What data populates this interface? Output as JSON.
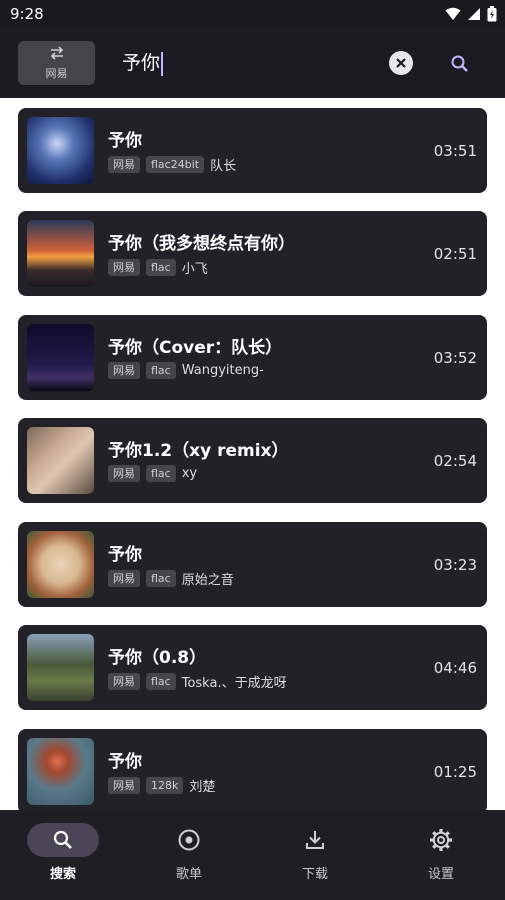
{
  "status": {
    "time": "9:28",
    "icons": [
      "wifi-icon",
      "signal-icon",
      "battery-icon"
    ]
  },
  "toolbar": {
    "source_label": "网易",
    "search_value": "予你",
    "icons": {
      "source": "swap-icon",
      "clear": "close-icon",
      "search": "search-icon"
    }
  },
  "songs": [
    {
      "title": "予你",
      "tags": [
        "网易",
        "flac24bit"
      ],
      "artist": "队长",
      "duration": "03:51"
    },
    {
      "title": "予你（我多想终点有你）",
      "tags": [
        "网易",
        "flac"
      ],
      "artist": "小飞",
      "duration": "02:51"
    },
    {
      "title": "予你（Cover：队长）",
      "tags": [
        "网易",
        "flac"
      ],
      "artist": "Wangyiteng-",
      "duration": "03:52"
    },
    {
      "title": "予你1.2（xy remix）",
      "tags": [
        "网易",
        "flac"
      ],
      "artist": "xy",
      "duration": "02:54"
    },
    {
      "title": "予你",
      "tags": [
        "网易",
        "flac"
      ],
      "artist": "原始之音",
      "duration": "03:23"
    },
    {
      "title": "予你（0.8）",
      "tags": [
        "网易",
        "flac"
      ],
      "artist": "Toska.、于成龙呀",
      "duration": "04:46"
    },
    {
      "title": "予你",
      "tags": [
        "网易",
        "128k"
      ],
      "artist": "刘楚",
      "duration": "01:25"
    }
  ],
  "nav": [
    {
      "label": "搜索",
      "icon": "search-icon",
      "active": true
    },
    {
      "label": "歌单",
      "icon": "disc-icon",
      "active": false
    },
    {
      "label": "下载",
      "icon": "download-icon",
      "active": false
    },
    {
      "label": "设置",
      "icon": "gear-icon",
      "active": false
    }
  ],
  "colors": {
    "background": "#ffffff",
    "card": "#222127",
    "appbar": "#1c1b21",
    "accent": "#c6b6ff",
    "nav_active": "#4a4658"
  }
}
